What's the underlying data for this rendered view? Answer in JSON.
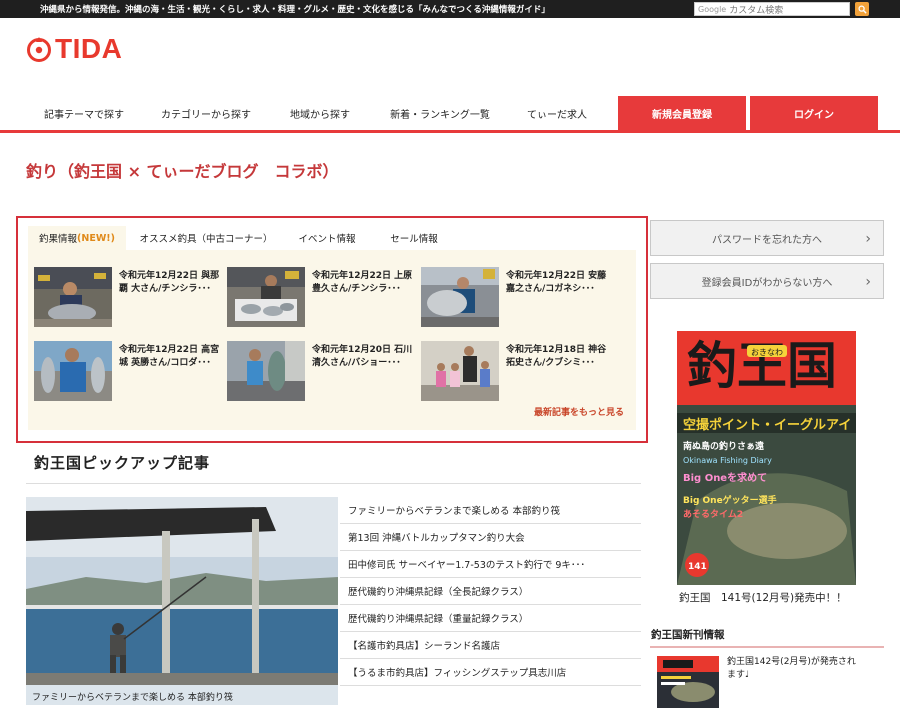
{
  "header": {
    "tagline": "沖縄県から情報発信。沖縄の海・生活・観光・くらし・求人・料理・グルメ・歴史・文化を感じる「みんなでつくる沖縄情報ガイド」",
    "search_logo": "Google",
    "search_placeholder": "カスタム検索",
    "logo_text": "TIDA"
  },
  "nav": {
    "items": [
      "記事テーマで探す",
      "カテゴリーから探す",
      "地域から探す",
      "新着・ランキング一覧",
      "てぃーだ求人"
    ],
    "register": "新規会員登録",
    "login": "ログイン"
  },
  "page": {
    "title": "釣り（釣王国 × てぃーだブログ　コラボ）"
  },
  "tabs": {
    "items": [
      {
        "label": "釣果情報",
        "badge": "(NEW!)"
      },
      {
        "label": "オススメ釣具（中古コーナー）"
      },
      {
        "label": "イベント情報"
      },
      {
        "label": "セール情報"
      }
    ],
    "active": 0
  },
  "cards": [
    {
      "text": "令和元年12月22日 與那覇 大さん/チンシラ･･･"
    },
    {
      "text": "令和元年12月22日 上原 豊久さん/チンシラ･･･"
    },
    {
      "text": "令和元年12月22日 安藤 嘉之さん/コガネシ･･･"
    },
    {
      "text": "令和元年12月22日 高宮城 英勝さん/コロダ･･･"
    },
    {
      "text": "令和元年12月20日 石川 清久さん/バショー･･･"
    },
    {
      "text": "令和元年12月18日 神谷 拓史さん/クブシミ･･･"
    }
  ],
  "more_link": "最新記事をもっと見る",
  "pickup": {
    "title": "釣王国ピックアップ記事",
    "hero_caption": "ファミリーからベテランまで楽しめる 本部釣り筏",
    "items": [
      "ファミリーからベテランまで楽しめる 本部釣り筏",
      "第13回 沖縄バトルカップタマン釣り大会",
      "田中修司氏 サーベイヤー1.7-53のテスト釣行で 9キ･･･",
      "歴代磯釣り沖縄県記録（全長記録クラス）",
      "歴代磯釣り沖縄県記録（重量記録クラス）",
      "【名護市釣具店】シーランド名護店",
      "【うるま市釣具店】フィッシングステップ具志川店"
    ]
  },
  "sidebar": {
    "forgot_password": "パスワードを忘れた方へ",
    "forgot_id": "登録会員IDがわからない方へ",
    "magazine": {
      "title_art": "釣王国",
      "okinawa": "おきなわ",
      "headline": "空撮ポイント・イーグルアイ",
      "sub1": "南ぬ島の釣りさぁ遠",
      "sub2": "Okinawa Fishing Diary",
      "sub3": "Big Oneを求めて",
      "sub4": "Big Oneゲッター選手",
      "sub5": "あそるタイム2",
      "issue_no": "141",
      "caption": "釣王国　141号(12月号)発売中！！"
    },
    "new_issue_title": "釣王国新刊情報",
    "new_issue_text": "釣王国142号(2月号)が発売されます♩"
  },
  "colors": {
    "brand_red": "#e73a3b",
    "tab_bg": "#fbf7e9",
    "top_bar": "#1f1f1f"
  }
}
